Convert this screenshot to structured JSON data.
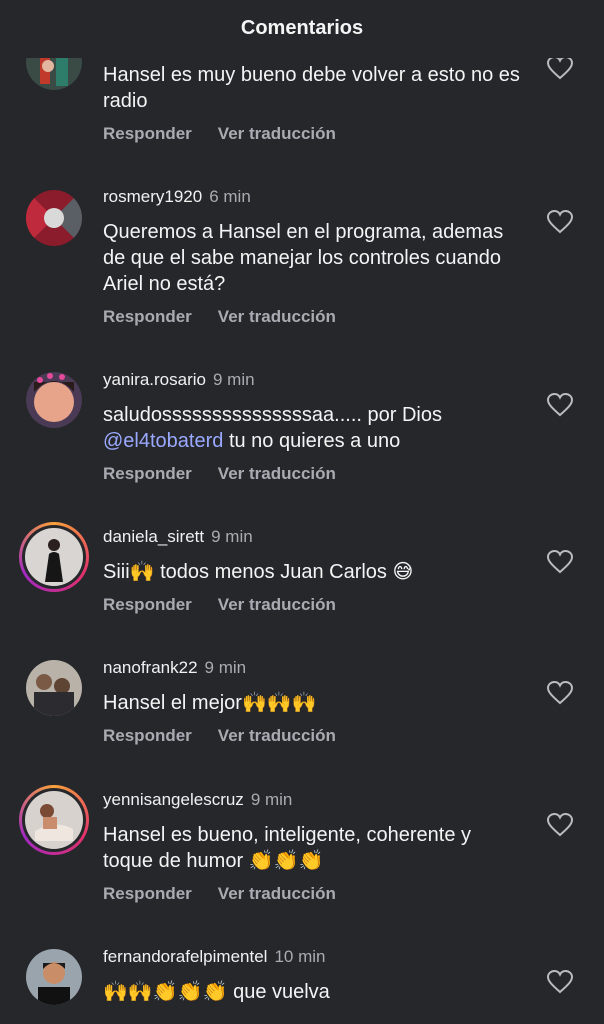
{
  "header": {
    "title": "Comentarios"
  },
  "actions": {
    "reply": "Responder",
    "translate": "Ver traducción"
  },
  "comments": [
    {
      "user": "",
      "time": "",
      "text": "Hansel es muy bueno debe volver a esto no es radio"
    },
    {
      "user": "rosmery1920",
      "time": "6 min",
      "text": "Queremos a Hansel en el programa, ademas de que el sabe manejar los controles cuando Ariel no está?"
    },
    {
      "user": "yanira.rosario",
      "time": "9 min",
      "text_before": "saludosssssssssssssssaa..... por Dios",
      "mention": "@el4tobaterd",
      "text_after": " tu no quieres a uno"
    },
    {
      "user": "daniela_sirett",
      "time": "9 min",
      "text": "Siii🙌 todos menos Juan Carlos 😅"
    },
    {
      "user": "nanofrank22",
      "time": "9 min",
      "text": "Hansel el mejor🙌🙌🙌"
    },
    {
      "user": "yennisangelescruz",
      "time": "9 min",
      "text": "Hansel es bueno, inteligente,  coherente y toque de humor 👏👏👏"
    },
    {
      "user": "fernandorafelpimentel",
      "time": "10 min",
      "text": "🙌🙌👏👏👏 que vuelva"
    }
  ]
}
